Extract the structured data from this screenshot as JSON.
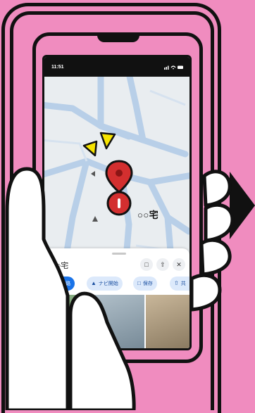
{
  "statusbar": {
    "time": "11:51",
    "icons": "signal-wifi-battery"
  },
  "map": {
    "place_label": "○○宅"
  },
  "place_sheet": {
    "title": "○○宅",
    "save_icon": "bookmark-icon",
    "share_icon": "share-icon",
    "close_icon": "close-icon",
    "chips": [
      {
        "label": "経路",
        "icon": "directions-icon"
      },
      {
        "label": "ナビ開始",
        "icon": "navigation-arrow-icon"
      },
      {
        "label": "保存",
        "icon": "bookmark-icon"
      },
      {
        "label": "共",
        "icon": "share-icon"
      }
    ]
  },
  "colors": {
    "background": "#f08cbf",
    "pin": "#d32f2f",
    "accent_blue": "#1a73e8",
    "arrow_yellow": "#f7e400"
  }
}
